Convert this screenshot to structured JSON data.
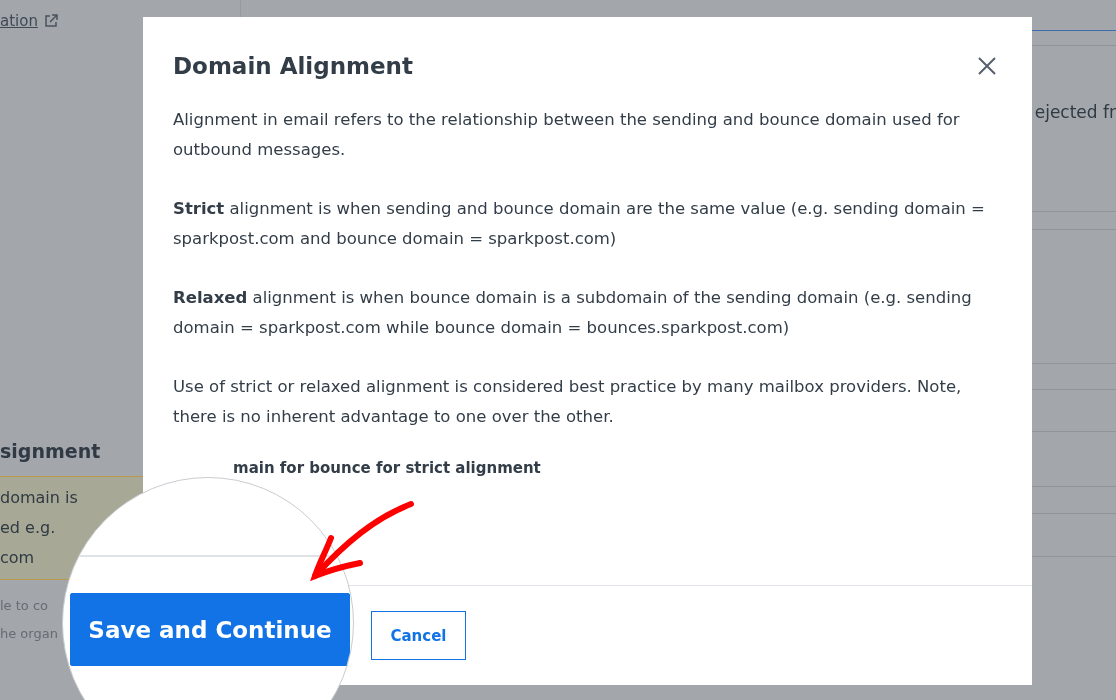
{
  "background": {
    "link": "ation",
    "heading": "signment",
    "notice_lines": [
      "domain is",
      "ed e.g.",
      "com"
    ],
    "footnote_lines": [
      "le to co",
      "he organ"
    ],
    "right_text": "ejected fr"
  },
  "dialog": {
    "title": "Domain Alignment",
    "paragraphs": [
      "Alignment in email refers to the relationship between the sending and bounce domain used for outbound messages.",
      "**Strict** alignment is when sending and bounce domain are the same value (e.g. sending domain = sparkpost.com and bounce domain = sparkpost.com)",
      "**Relaxed** alignment is when bounce domain is a subdomain of the sending domain (e.g. sending domain = sparkpost.com while bounce domain = bounces.sparkpost.com)",
      "Use of strict or relaxed alignment is considered best practice by many mailbox providers. Note, there is no inherent advantage to one over the other."
    ],
    "field_label": "main for bounce for strict alignment",
    "buttons": [
      {
        "label": "Cancel",
        "kind": "secondary"
      }
    ]
  },
  "magnifier": {
    "buttons": [
      {
        "label": "Save and Continue",
        "kind": "primary"
      }
    ]
  }
}
